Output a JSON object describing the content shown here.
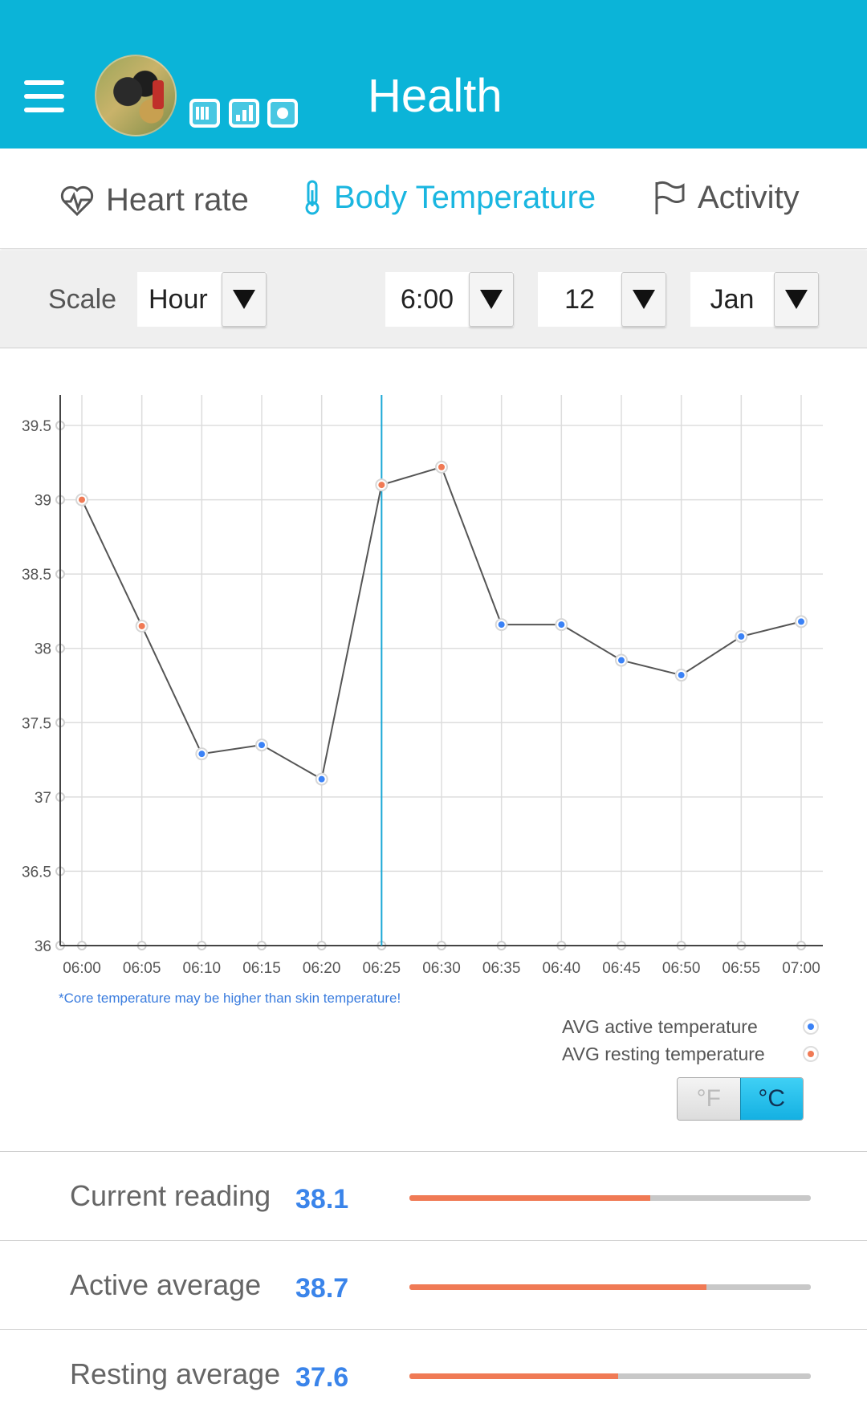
{
  "header": {
    "title": "Health",
    "bg_color": "#0bb4d8",
    "icons": [
      "menu-icon",
      "battery-icon",
      "signal-icon",
      "camera-icon"
    ]
  },
  "tabs": [
    {
      "label": "Heart rate",
      "icon": "heart-icon",
      "active": false
    },
    {
      "label": "Body Temperature",
      "icon": "thermometer-icon",
      "active": true
    },
    {
      "label": "Activity",
      "icon": "flag-icon",
      "active": false
    }
  ],
  "filter": {
    "scale_label": "Scale",
    "scale_value": "Hour",
    "time_value": "6:00",
    "day_value": "12",
    "month_value": "Jan"
  },
  "chart_data": {
    "type": "line",
    "x": [
      "06:00",
      "06:05",
      "06:10",
      "06:15",
      "06:20",
      "06:25",
      "06:30",
      "06:35",
      "06:40",
      "06:45",
      "06:50",
      "06:55",
      "07:00"
    ],
    "y": [
      39.0,
      38.15,
      37.29,
      37.35,
      37.12,
      39.1,
      39.22,
      38.16,
      38.16,
      37.92,
      37.82,
      38.08,
      38.18
    ],
    "point_type": [
      "resting",
      "resting",
      "active",
      "active",
      "active",
      "resting",
      "resting",
      "active",
      "active",
      "active",
      "active",
      "active",
      "active"
    ],
    "ylim": [
      36,
      39.7
    ],
    "yticks": [
      "36",
      "36.5",
      "37",
      "37.5",
      "38",
      "38.5",
      "39",
      "39.5"
    ],
    "selected_x": "06:25",
    "grid": true,
    "colors": {
      "active": "#3b82f6",
      "resting": "#f07a55",
      "line": "#555555",
      "cursor": "#1aa8d6"
    }
  },
  "note": "*Core temperature may be higher than skin temperature!",
  "legend": {
    "active": "AVG active temperature",
    "resting": "AVG resting temperature"
  },
  "units": {
    "f": "°F",
    "c": "°C",
    "selected": "c"
  },
  "stats": [
    {
      "label": "Current reading",
      "value": "38.1",
      "fill": 0.6
    },
    {
      "label": "Active average",
      "value": "38.7",
      "fill": 0.74
    },
    {
      "label": "Resting average",
      "value": "37.6",
      "fill": 0.52
    }
  ]
}
